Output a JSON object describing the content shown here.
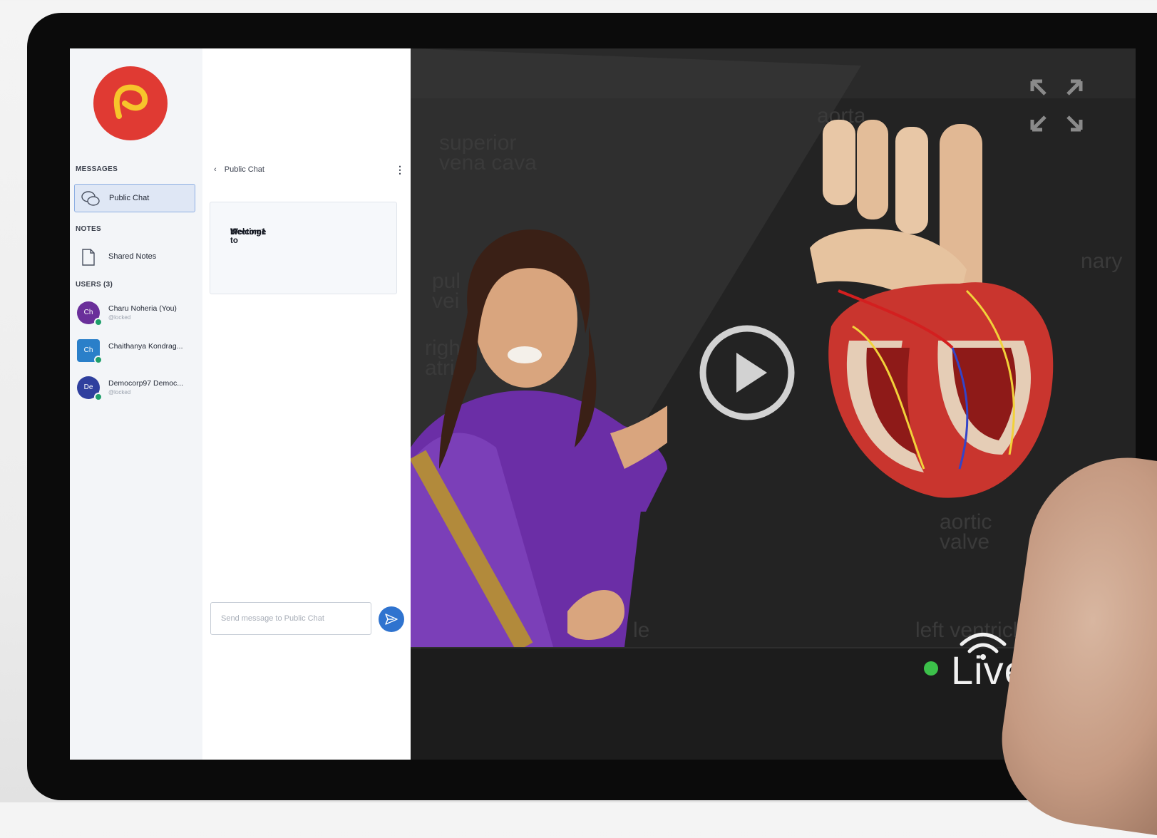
{
  "sidebar": {
    "messages_heading": "MESSAGES",
    "public_chat_label": "Public Chat",
    "notes_heading": "NOTES",
    "shared_notes_label": "Shared Notes",
    "users_heading": "USERS (3)",
    "users": [
      {
        "initials": "Ch",
        "name": "Charu Noheria (You)",
        "status": "@locked",
        "color": "#6a2f9a"
      },
      {
        "initials": "Ch",
        "name": "Chaithanya Kondrag...",
        "status": "",
        "color": "#2a7fc9"
      },
      {
        "initials": "De",
        "name": "Democorp97 Democ...",
        "status": "@locked",
        "color": "#2f3f9e"
      }
    ]
  },
  "chat": {
    "header": "Public Chat",
    "back_glyph": "‹",
    "menu_glyph": "⋮",
    "welcome_prefix": "Welcome to ",
    "welcome_meeting": "Meeting1",
    "welcome_suffix": "!",
    "input_placeholder": "Send message to Public Chat"
  },
  "video": {
    "background_labels": [
      "superior",
      "vena cava",
      "aorta",
      "pul",
      "vei",
      "righ",
      "atri",
      "nary",
      "aortic",
      "valve",
      "left ventricle",
      "le"
    ],
    "live_label": "Live"
  },
  "colors": {
    "brand_red": "#e03a33",
    "brand_yellow": "#f7c52b",
    "accent_blue": "#2f73cf",
    "live_green": "#3cc04a"
  },
  "icons": [
    "brand-logo-icon",
    "chat-bubbles-icon",
    "notes-document-icon",
    "send-icon",
    "fullscreen-icon",
    "play-icon",
    "wifi-icon"
  ]
}
